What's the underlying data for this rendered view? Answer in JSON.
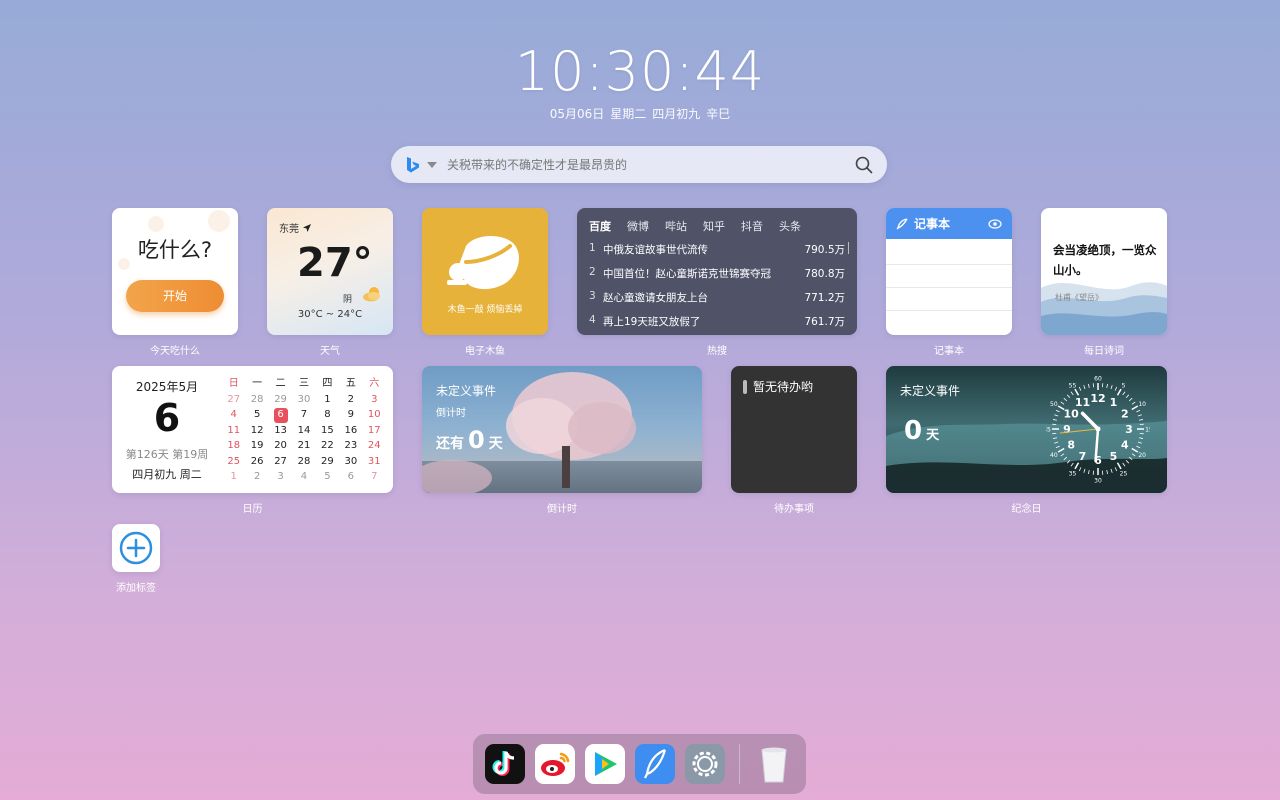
{
  "clock": {
    "time": "10:30:44",
    "date": "05月06日",
    "weekday": "星期二",
    "lunar": "四月初九",
    "ganzhi": "辛巳"
  },
  "search": {
    "engine_icon": "bing-icon",
    "placeholder": "关税带来的不确定性才是最昂贵的"
  },
  "eat": {
    "question": "吃什么?",
    "button": "开始",
    "label": "今天吃什么"
  },
  "weather": {
    "city": "东莞",
    "temp": "27°",
    "condition": "阴",
    "range": "30°C ~ 24°C",
    "label": "天气"
  },
  "fish": {
    "caption": "木鱼一敲 烦恼丢掉",
    "label": "电子木鱼"
  },
  "hot": {
    "tabs": [
      "百度",
      "微博",
      "哔站",
      "知乎",
      "抖音",
      "头条"
    ],
    "active_tab": "百度",
    "items": [
      {
        "rank": "1",
        "title": "中俄友谊故事世代流传",
        "value": "790.5万"
      },
      {
        "rank": "2",
        "title": "中国首位！赵心童斯诺克世锦赛夺冠",
        "value": "780.8万"
      },
      {
        "rank": "3",
        "title": "赵心童邀请女朋友上台",
        "value": "771.2万"
      },
      {
        "rank": "4",
        "title": "再上19天班又放假了",
        "value": "761.7万"
      }
    ],
    "label": "热搜"
  },
  "notebook": {
    "title": "记事本",
    "label": "记事本"
  },
  "poem": {
    "text": "会当凌绝顶，一览众山小。",
    "author": "杜甫《望岳》",
    "label": "每日诗词"
  },
  "calendar": {
    "year_month": "2025年5月",
    "day": "6",
    "week_info": "第126天 第19周",
    "lunar": "四月初九 周二",
    "headers": [
      "日",
      "一",
      "二",
      "三",
      "四",
      "五",
      "六"
    ],
    "cells": [
      "27",
      "28",
      "29",
      "30",
      "1",
      "2",
      "3",
      "4",
      "5",
      "6",
      "7",
      "8",
      "9",
      "10",
      "11",
      "12",
      "13",
      "14",
      "15",
      "16",
      "17",
      "18",
      "19",
      "20",
      "21",
      "22",
      "23",
      "24",
      "25",
      "26",
      "27",
      "28",
      "29",
      "30",
      "31",
      "1",
      "2",
      "3",
      "4",
      "5",
      "6",
      "7"
    ],
    "label": "日历"
  },
  "countdown": {
    "event": "未定义事件",
    "subtitle": "倒计时",
    "prefix": "还有",
    "days": "0",
    "unit": "天",
    "label": "倒计时"
  },
  "todo": {
    "empty": "暂无待办哟",
    "label": "待办事项"
  },
  "anniversary": {
    "event": "未定义事件",
    "days": "0",
    "unit": "天",
    "clock_numbers": [
      "12",
      "1",
      "2",
      "3",
      "4",
      "5",
      "6",
      "7",
      "8",
      "9",
      "10",
      "11"
    ],
    "clock_minute_labels": [
      "60",
      "5",
      "10",
      "15",
      "20",
      "25",
      "30",
      "35",
      "40",
      "45",
      "50",
      "55"
    ],
    "label": "纪念日"
  },
  "add": {
    "label": "添加标签"
  },
  "dock": {
    "apps": [
      "tiktok-icon",
      "weibo-icon",
      "video-player-icon",
      "notebook-icon",
      "settings-icon",
      "trash-icon"
    ]
  },
  "colors": {
    "accent_orange": "#ee8d32",
    "accent_blue": "#4c91ef",
    "today_red": "#e8505c"
  }
}
